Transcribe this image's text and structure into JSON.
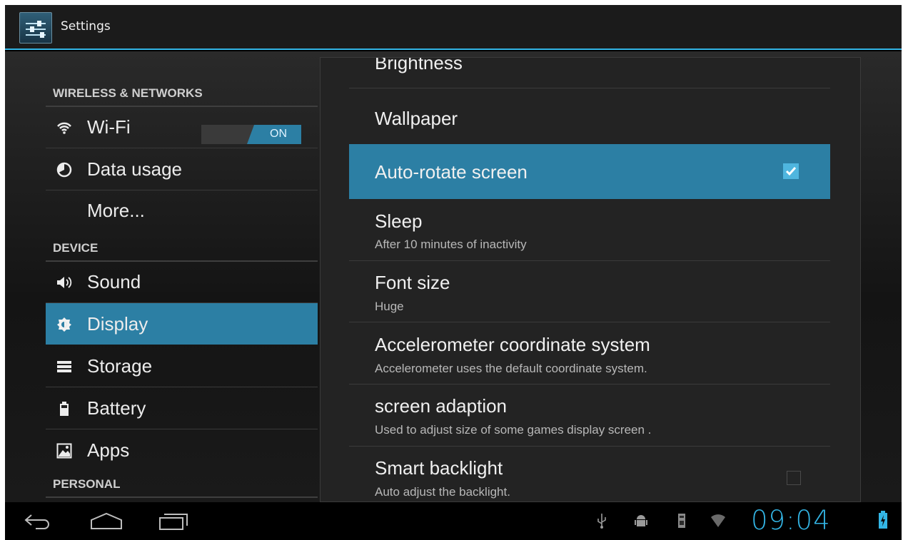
{
  "action_bar": {
    "title": "Settings",
    "icon": "settings-sliders-icon"
  },
  "sidebar": {
    "headers": {
      "wireless": "WIRELESS & NETWORKS",
      "device": "DEVICE",
      "personal": "PERSONAL"
    },
    "items": [
      {
        "label": "Wi-Fi",
        "icon": "wifi-icon"
      },
      {
        "label": "Data usage",
        "icon": "data-usage-icon"
      },
      {
        "label": "More...",
        "icon": ""
      },
      {
        "label": "Sound",
        "icon": "speaker-icon"
      },
      {
        "label": "Display",
        "icon": "display-brightness-icon",
        "selected": true
      },
      {
        "label": "Storage",
        "icon": "storage-icon"
      },
      {
        "label": "Battery",
        "icon": "battery-icon"
      },
      {
        "label": "Apps",
        "icon": "apps-icon"
      }
    ],
    "wifi_toggle": "ON"
  },
  "display_settings": {
    "brightness": {
      "title": "Brightness"
    },
    "wallpaper": {
      "title": "Wallpaper"
    },
    "auto_rotate": {
      "title": "Auto-rotate screen",
      "checked": true
    },
    "sleep": {
      "title": "Sleep",
      "summary": "After 10 minutes of inactivity"
    },
    "font_size": {
      "title": "Font size",
      "summary": "Huge"
    },
    "accelerometer": {
      "title": "Accelerometer coordinate system",
      "summary": "Accelerometer uses the default coordinate system."
    },
    "screen_adaption": {
      "title": "screen adaption",
      "summary": "Used to adjust size of some games display screen ."
    },
    "smart_backlight": {
      "title": "Smart backlight",
      "summary": "Auto adjust the backlight.",
      "checked": false
    }
  },
  "navbar": {
    "back": "back-icon",
    "home": "home-icon",
    "recents": "recent-apps-icon",
    "status_icons": [
      "usb-icon",
      "android-debug-icon",
      "sd-card-icon",
      "wifi-signal-icon",
      "battery-charging-icon"
    ],
    "clock": "09:04"
  },
  "colors": {
    "accent": "#33b5e5",
    "selected": "#2c7fa4"
  }
}
